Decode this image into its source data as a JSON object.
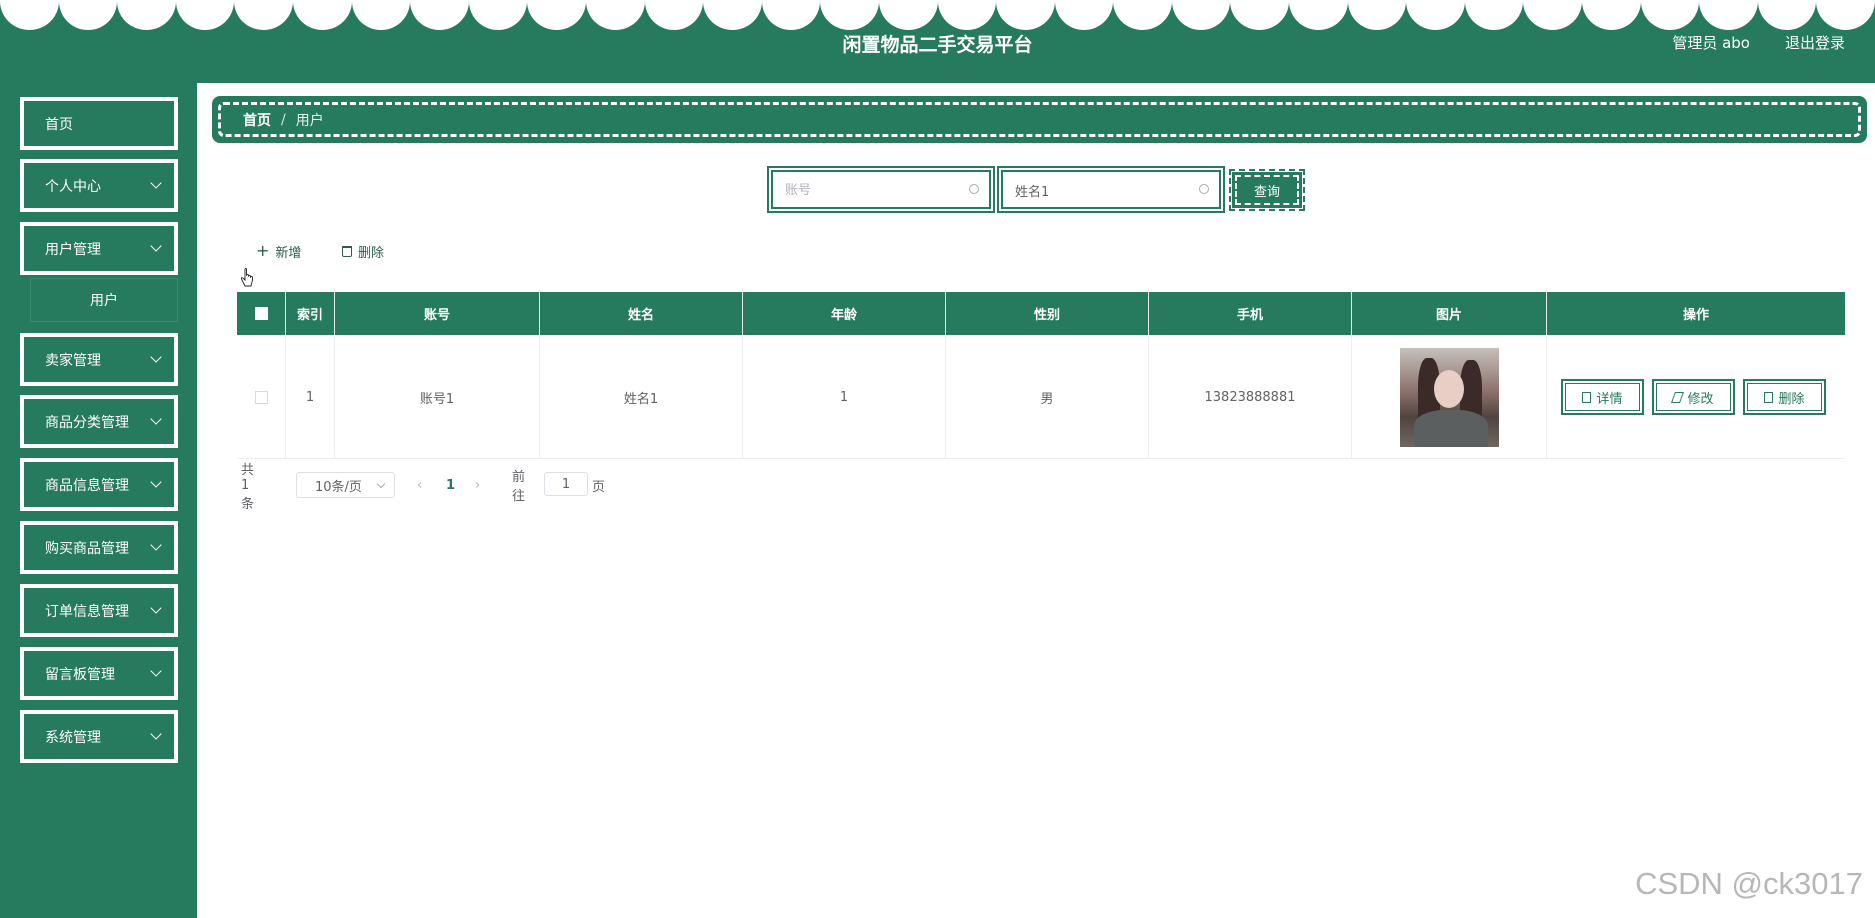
{
  "header": {
    "title": "闲置物品二手交易平台",
    "user": "管理员 abo",
    "logout": "退出登录"
  },
  "sidebar": {
    "items": [
      {
        "label": "首页"
      },
      {
        "label": "个人中心"
      },
      {
        "label": "用户管理"
      },
      {
        "label": "卖家管理"
      },
      {
        "label": "商品分类管理"
      },
      {
        "label": "商品信息管理"
      },
      {
        "label": "购买商品管理"
      },
      {
        "label": "订单信息管理"
      },
      {
        "label": "留言板管理"
      },
      {
        "label": "系统管理"
      }
    ],
    "sub_item": "用户"
  },
  "breadcrumb": {
    "home": "首页",
    "separator": "/",
    "current": "用户"
  },
  "search": {
    "account_placeholder": "账号",
    "account_value": "",
    "name_value": "姓名1",
    "query_label": "查询"
  },
  "toolbar": {
    "add_label": "新增",
    "delete_label": "删除"
  },
  "table": {
    "headers": [
      "索引",
      "账号",
      "姓名",
      "年龄",
      "性别",
      "手机",
      "图片",
      "操作"
    ],
    "rows": [
      {
        "index": "1",
        "account": "账号1",
        "name": "姓名1",
        "age": "1",
        "gender": "男",
        "phone": "13823888881"
      }
    ],
    "actions": {
      "detail": "详情",
      "edit": "修改",
      "delete": "删除"
    }
  },
  "pagination": {
    "total": "共 1 条",
    "page_size": "10条/页",
    "current_page": "1",
    "goto_prefix": "前往",
    "goto_value": "1",
    "goto_suffix": "页"
  },
  "watermark": "CSDN @ck3017",
  "colors": {
    "primary": "#267a5e",
    "white": "#ffffff"
  }
}
